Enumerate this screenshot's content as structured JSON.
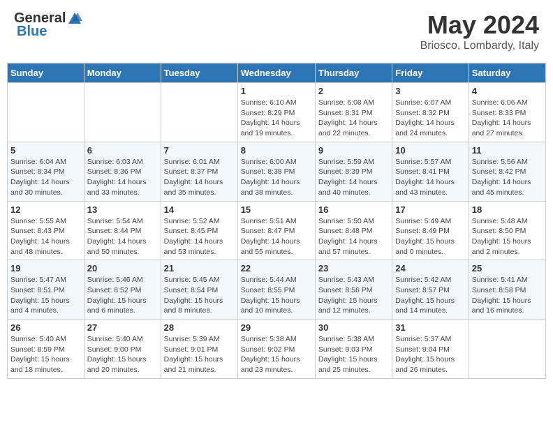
{
  "header": {
    "logo_general": "General",
    "logo_blue": "Blue",
    "month_title": "May 2024",
    "location": "Briosco, Lombardy, Italy"
  },
  "days_of_week": [
    "Sunday",
    "Monday",
    "Tuesday",
    "Wednesday",
    "Thursday",
    "Friday",
    "Saturday"
  ],
  "weeks": [
    [
      {
        "num": "",
        "info": ""
      },
      {
        "num": "",
        "info": ""
      },
      {
        "num": "",
        "info": ""
      },
      {
        "num": "1",
        "info": "Sunrise: 6:10 AM\nSunset: 8:29 PM\nDaylight: 14 hours\nand 19 minutes."
      },
      {
        "num": "2",
        "info": "Sunrise: 6:08 AM\nSunset: 8:31 PM\nDaylight: 14 hours\nand 22 minutes."
      },
      {
        "num": "3",
        "info": "Sunrise: 6:07 AM\nSunset: 8:32 PM\nDaylight: 14 hours\nand 24 minutes."
      },
      {
        "num": "4",
        "info": "Sunrise: 6:06 AM\nSunset: 8:33 PM\nDaylight: 14 hours\nand 27 minutes."
      }
    ],
    [
      {
        "num": "5",
        "info": "Sunrise: 6:04 AM\nSunset: 8:34 PM\nDaylight: 14 hours\nand 30 minutes."
      },
      {
        "num": "6",
        "info": "Sunrise: 6:03 AM\nSunset: 8:36 PM\nDaylight: 14 hours\nand 33 minutes."
      },
      {
        "num": "7",
        "info": "Sunrise: 6:01 AM\nSunset: 8:37 PM\nDaylight: 14 hours\nand 35 minutes."
      },
      {
        "num": "8",
        "info": "Sunrise: 6:00 AM\nSunset: 8:38 PM\nDaylight: 14 hours\nand 38 minutes."
      },
      {
        "num": "9",
        "info": "Sunrise: 5:59 AM\nSunset: 8:39 PM\nDaylight: 14 hours\nand 40 minutes."
      },
      {
        "num": "10",
        "info": "Sunrise: 5:57 AM\nSunset: 8:41 PM\nDaylight: 14 hours\nand 43 minutes."
      },
      {
        "num": "11",
        "info": "Sunrise: 5:56 AM\nSunset: 8:42 PM\nDaylight: 14 hours\nand 45 minutes."
      }
    ],
    [
      {
        "num": "12",
        "info": "Sunrise: 5:55 AM\nSunset: 8:43 PM\nDaylight: 14 hours\nand 48 minutes."
      },
      {
        "num": "13",
        "info": "Sunrise: 5:54 AM\nSunset: 8:44 PM\nDaylight: 14 hours\nand 50 minutes."
      },
      {
        "num": "14",
        "info": "Sunrise: 5:52 AM\nSunset: 8:45 PM\nDaylight: 14 hours\nand 53 minutes."
      },
      {
        "num": "15",
        "info": "Sunrise: 5:51 AM\nSunset: 8:47 PM\nDaylight: 14 hours\nand 55 minutes."
      },
      {
        "num": "16",
        "info": "Sunrise: 5:50 AM\nSunset: 8:48 PM\nDaylight: 14 hours\nand 57 minutes."
      },
      {
        "num": "17",
        "info": "Sunrise: 5:49 AM\nSunset: 8:49 PM\nDaylight: 15 hours\nand 0 minutes."
      },
      {
        "num": "18",
        "info": "Sunrise: 5:48 AM\nSunset: 8:50 PM\nDaylight: 15 hours\nand 2 minutes."
      }
    ],
    [
      {
        "num": "19",
        "info": "Sunrise: 5:47 AM\nSunset: 8:51 PM\nDaylight: 15 hours\nand 4 minutes."
      },
      {
        "num": "20",
        "info": "Sunrise: 5:46 AM\nSunset: 8:52 PM\nDaylight: 15 hours\nand 6 minutes."
      },
      {
        "num": "21",
        "info": "Sunrise: 5:45 AM\nSunset: 8:54 PM\nDaylight: 15 hours\nand 8 minutes."
      },
      {
        "num": "22",
        "info": "Sunrise: 5:44 AM\nSunset: 8:55 PM\nDaylight: 15 hours\nand 10 minutes."
      },
      {
        "num": "23",
        "info": "Sunrise: 5:43 AM\nSunset: 8:56 PM\nDaylight: 15 hours\nand 12 minutes."
      },
      {
        "num": "24",
        "info": "Sunrise: 5:42 AM\nSunset: 8:57 PM\nDaylight: 15 hours\nand 14 minutes."
      },
      {
        "num": "25",
        "info": "Sunrise: 5:41 AM\nSunset: 8:58 PM\nDaylight: 15 hours\nand 16 minutes."
      }
    ],
    [
      {
        "num": "26",
        "info": "Sunrise: 5:40 AM\nSunset: 8:59 PM\nDaylight: 15 hours\nand 18 minutes."
      },
      {
        "num": "27",
        "info": "Sunrise: 5:40 AM\nSunset: 9:00 PM\nDaylight: 15 hours\nand 20 minutes."
      },
      {
        "num": "28",
        "info": "Sunrise: 5:39 AM\nSunset: 9:01 PM\nDaylight: 15 hours\nand 21 minutes."
      },
      {
        "num": "29",
        "info": "Sunrise: 5:38 AM\nSunset: 9:02 PM\nDaylight: 15 hours\nand 23 minutes."
      },
      {
        "num": "30",
        "info": "Sunrise: 5:38 AM\nSunset: 9:03 PM\nDaylight: 15 hours\nand 25 minutes."
      },
      {
        "num": "31",
        "info": "Sunrise: 5:37 AM\nSunset: 9:04 PM\nDaylight: 15 hours\nand 26 minutes."
      },
      {
        "num": "",
        "info": ""
      }
    ]
  ]
}
